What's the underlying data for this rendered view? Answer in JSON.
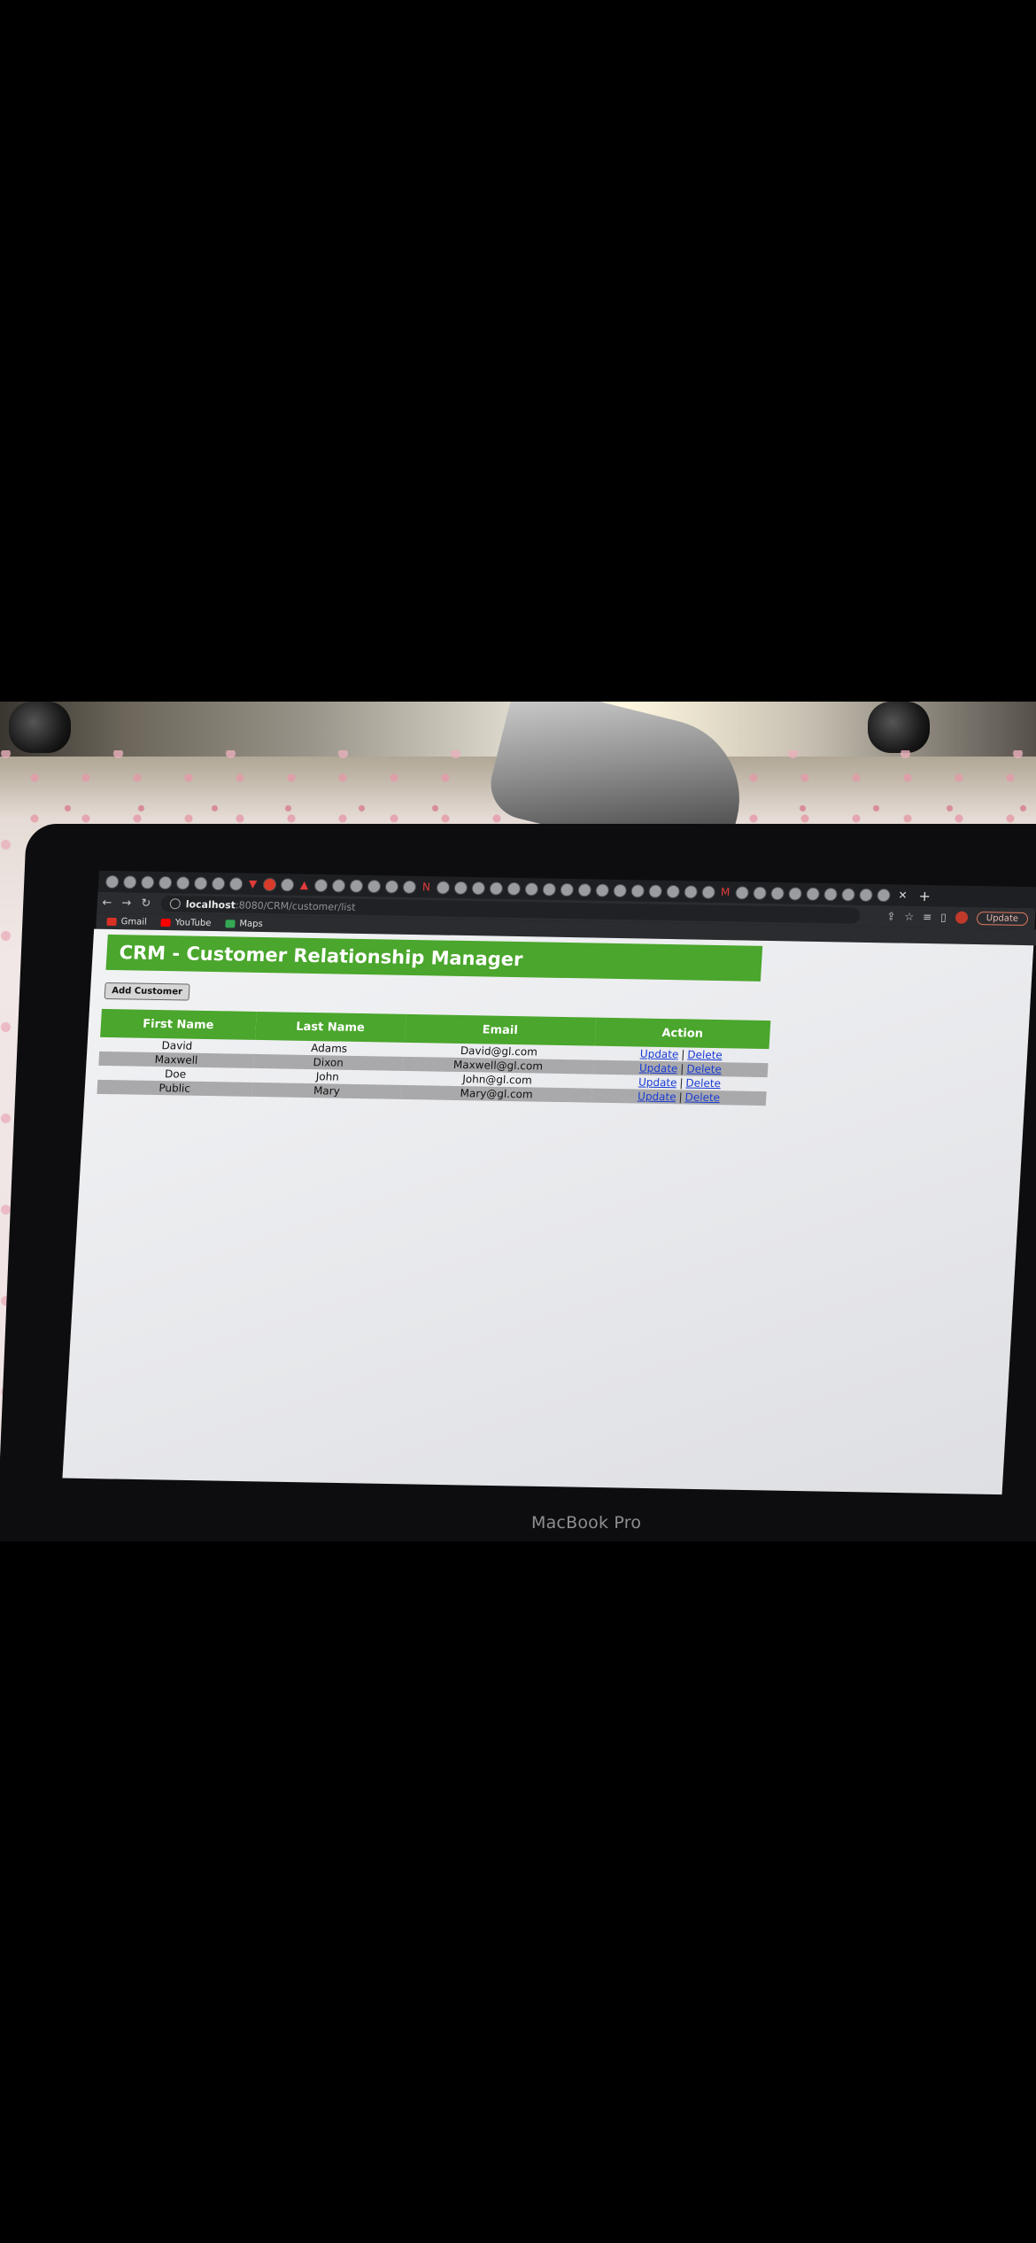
{
  "browser": {
    "url_host": "localhost",
    "url_path": ":8080/CRM/customer/list",
    "update_label": "Update",
    "bookmarks": [
      {
        "label": "Gmail",
        "color": "#d93025"
      },
      {
        "label": "YouTube",
        "color": "#ff0000"
      },
      {
        "label": "Maps",
        "color": "#34a853"
      }
    ]
  },
  "app": {
    "title": "CRM - Customer Relationship Manager",
    "add_button_label": "Add Customer"
  },
  "table": {
    "headers": [
      "First Name",
      "Last Name",
      "Email",
      "Action"
    ],
    "update_label": "Update",
    "delete_label": "Delete",
    "separator": "|",
    "rows": [
      {
        "first": "David",
        "last": "Adams",
        "email": "David@gl.com"
      },
      {
        "first": "Maxwell",
        "last": "Dixon",
        "email": "Maxwell@gl.com"
      },
      {
        "first": "Doe",
        "last": "John",
        "email": "John@gl.com"
      },
      {
        "first": "Public",
        "last": "Mary",
        "email": "Mary@gl.com"
      }
    ]
  },
  "device": {
    "label": "MacBook Pro"
  },
  "colors": {
    "header_green": "#4aa62c",
    "link_blue": "#1a3bd4",
    "alt_row": "#a9a9ab"
  }
}
